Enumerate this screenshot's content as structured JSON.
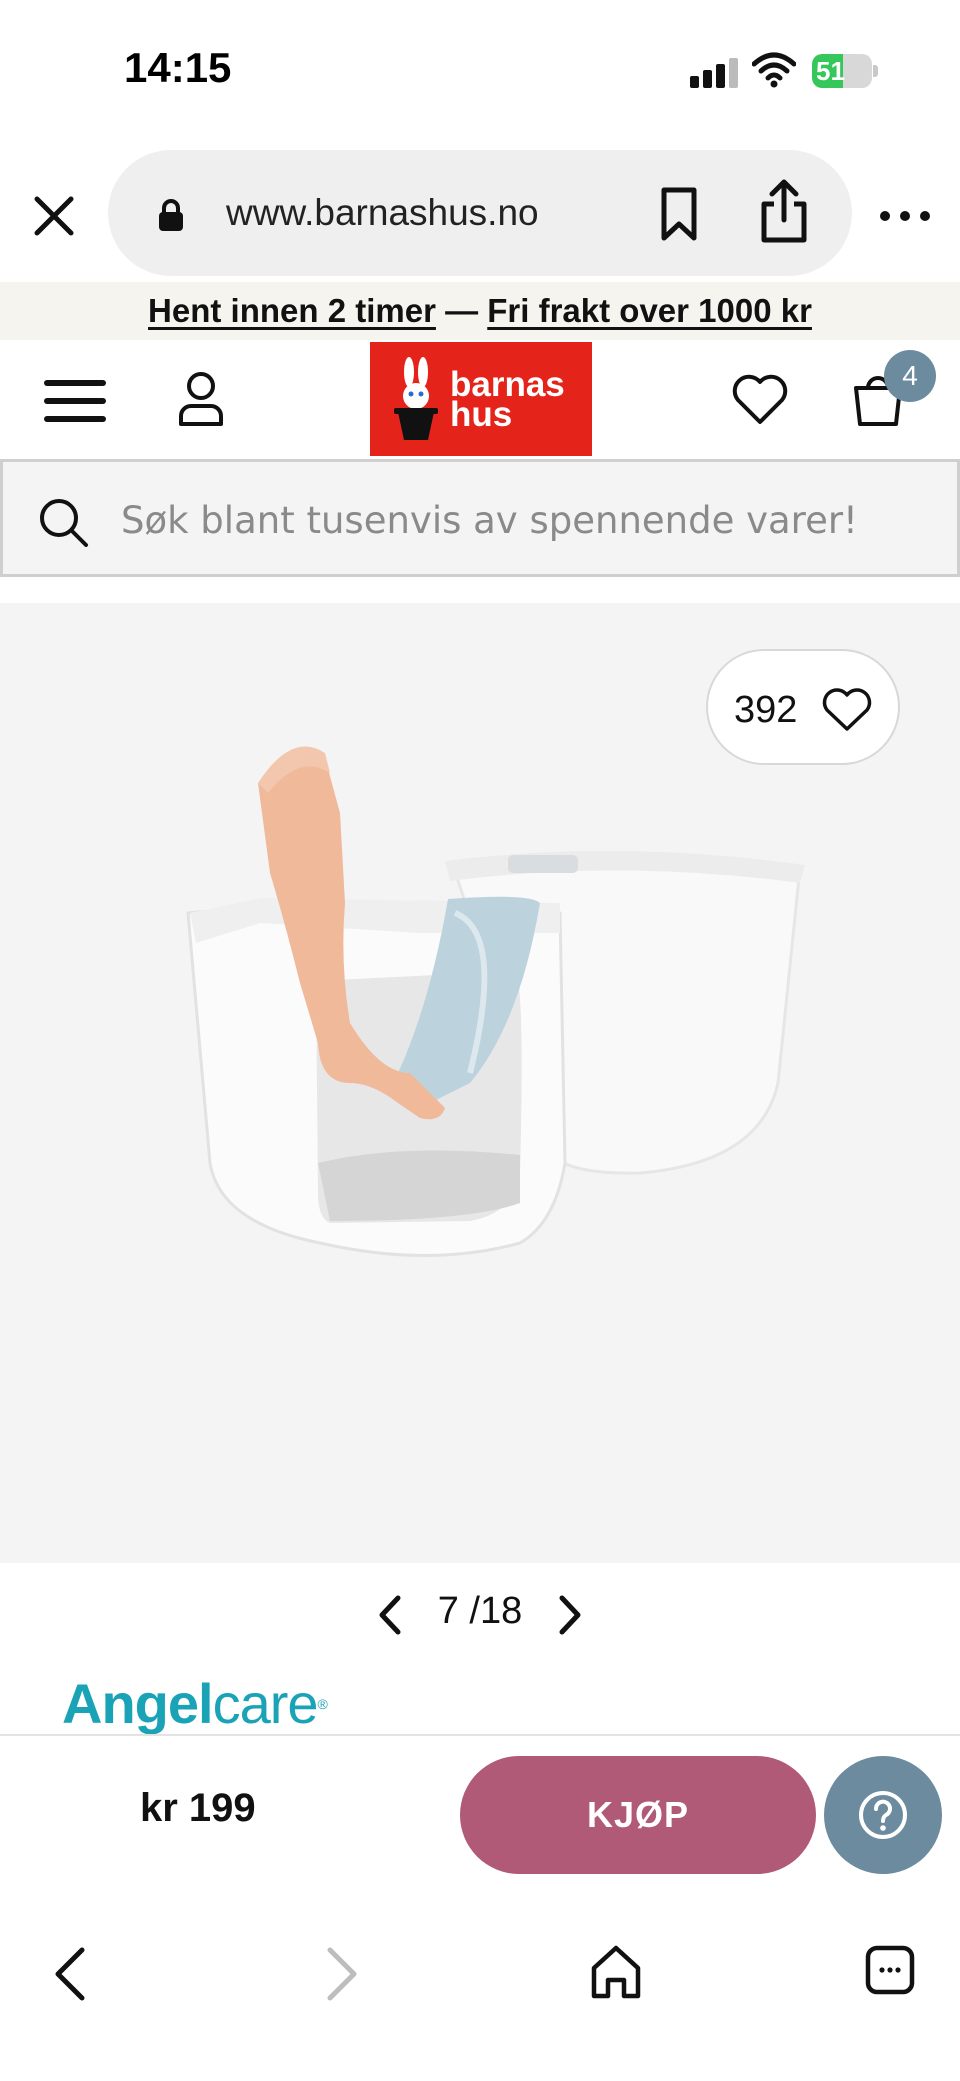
{
  "status_bar": {
    "time": "14:15",
    "battery_level": "51",
    "battery_fraction": 0.51
  },
  "browser": {
    "url": "www.barnashus.no"
  },
  "promo": {
    "pickup": "Hent innen 2 timer",
    "separator": "—",
    "shipping": "Fri frakt over 1000 kr"
  },
  "header": {
    "logo_line1": "barnas",
    "logo_line2": "hus",
    "cart_count": "4",
    "accent_color": "#e4231b"
  },
  "search": {
    "placeholder": "Søk blant tusenvis av spennende varer!"
  },
  "product": {
    "favorites_count": "392",
    "image_current": "7",
    "image_separator": "/",
    "image_total": "18",
    "brand_part1": "Angel",
    "brand_part2": "care",
    "brand_mark": "®",
    "brand_color": "#1aa3b6"
  },
  "buy_bar": {
    "price": "kr 199",
    "buy_label": "KJØP",
    "buy_color": "#b05a78",
    "help_color": "#6d8b9e"
  },
  "icons": [
    "close-icon",
    "lock-icon",
    "bookmark-icon",
    "share-icon",
    "more-icon",
    "menu-icon",
    "user-icon",
    "heart-icon",
    "bag-icon",
    "search-icon",
    "chevron-left-icon",
    "chevron-right-icon",
    "question-icon",
    "home-icon",
    "tabs-icon"
  ]
}
